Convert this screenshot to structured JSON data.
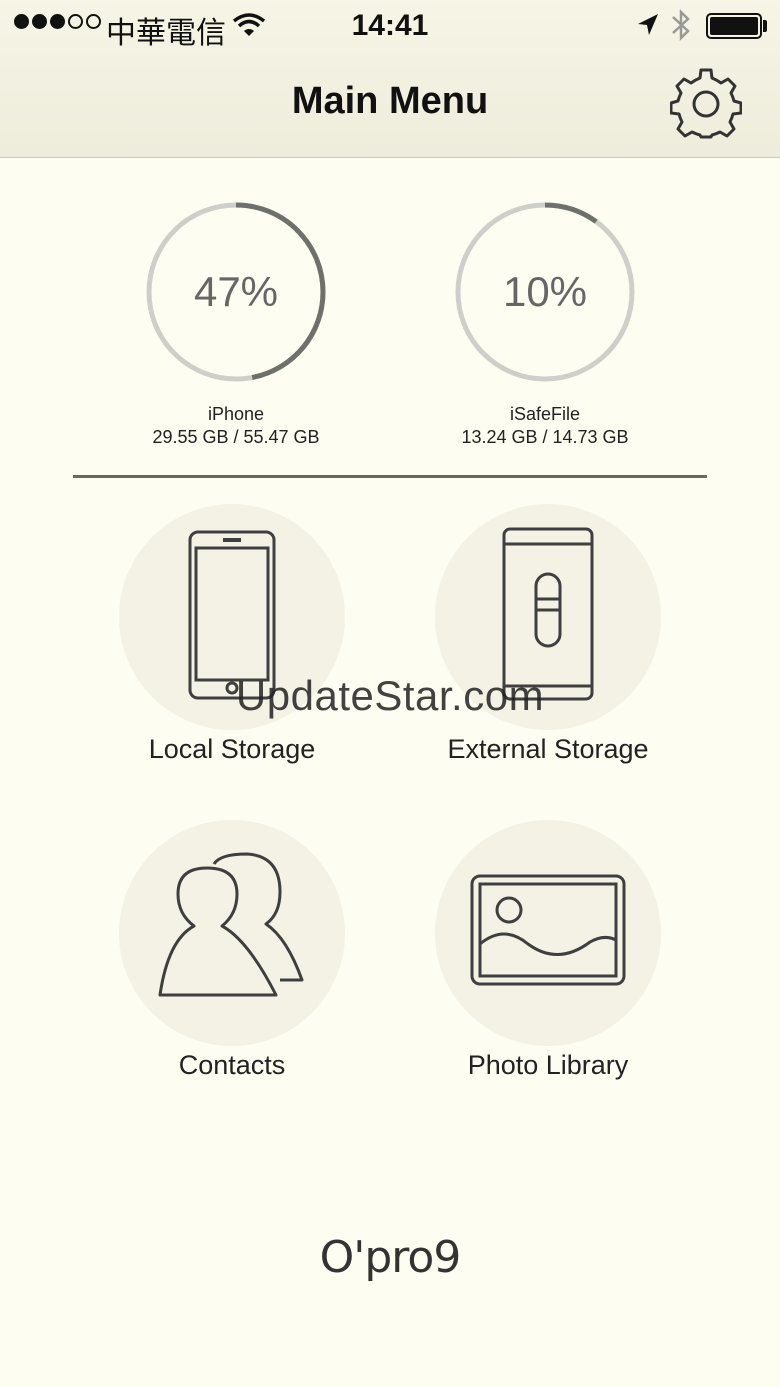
{
  "status_bar": {
    "carrier": "中華電信",
    "time": "14:41",
    "signal_bars_filled": 3,
    "signal_bars_total": 5
  },
  "nav": {
    "title": "Main Menu",
    "settings_icon": "gear-icon"
  },
  "storage": [
    {
      "percent_label": "47%",
      "percent": 0.47,
      "name": "iPhone",
      "usage": "29.55 GB / 55.47 GB"
    },
    {
      "percent_label": "10%",
      "percent": 0.1,
      "name": "iSafeFile",
      "usage": "13.24 GB / 14.73 GB"
    }
  ],
  "menu": [
    {
      "label": "Local Storage",
      "icon": "phone-icon"
    },
    {
      "label": "External Storage",
      "icon": "usb-drive-icon"
    },
    {
      "label": "Contacts",
      "icon": "contacts-icon"
    },
    {
      "label": "Photo Library",
      "icon": "photo-icon"
    }
  ],
  "watermark": "UpdateStar.com",
  "brand": "O'pro9",
  "colors": {
    "background": "#fdfdf1",
    "ring_track": "#cfcfca",
    "ring_progress": "#6e716a",
    "icon_stroke": "#3f3f3f"
  }
}
